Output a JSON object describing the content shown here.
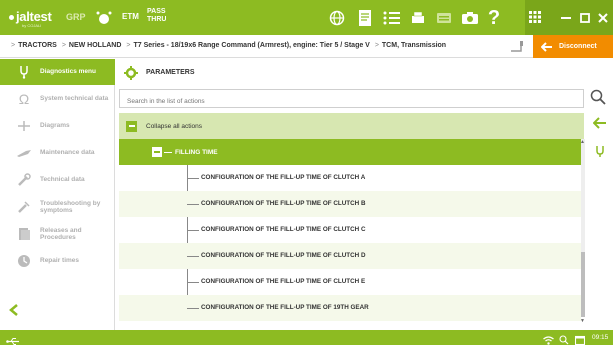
{
  "topbar": {
    "logo": "jaltest",
    "logo_sub": "by COJALI",
    "grp": "GRP",
    "etm": "ETM",
    "passthru_line1": "PASS",
    "passthru_line2": "THRU",
    "help": "?"
  },
  "breadcrumb": {
    "items": [
      "TRACTORS",
      "NEW HOLLAND",
      "T7 Series - 18/19x6 Range Command (Armrest), engine: Tier 5 / Stage V",
      "TCM, Transmission"
    ],
    "disconnect_label": "Disconnect"
  },
  "sidebar": {
    "items": [
      {
        "label": "Diagnostics menu",
        "icon": "diagnostics-icon",
        "active": true
      },
      {
        "label": "System technical data",
        "icon": "omega-icon"
      },
      {
        "label": "Diagrams",
        "icon": "diagram-icon"
      },
      {
        "label": "Maintenance data",
        "icon": "maintenance-icon"
      },
      {
        "label": "Technical data",
        "icon": "wrench-icon"
      },
      {
        "label": "Troubleshooting by symptoms",
        "icon": "troubleshooting-icon"
      },
      {
        "label": "Releases and Procedures",
        "icon": "procedures-icon"
      },
      {
        "label": "Repair times",
        "icon": "repair-times-icon"
      }
    ]
  },
  "main": {
    "title": "PARAMETERS",
    "search_placeholder": "Search in the list of actions",
    "collapse_label": "Collapse all actions",
    "group_label": "FILLING TIME",
    "actions": [
      "CONFIGURATION OF THE FILL-UP TIME OF CLUTCH A",
      "CONFIGURATION OF THE FILL-UP TIME OF CLUTCH B",
      "CONFIGURATION OF THE FILL-UP TIME OF CLUTCH C",
      "CONFIGURATION OF THE FILL-UP TIME OF CLUTCH D",
      "CONFIGURATION OF THE FILL-UP TIME OF CLUTCH E",
      "CONFIGURATION OF THE FILL-UP TIME OF 19TH GEAR"
    ]
  },
  "statusbar": {
    "time": "09:15"
  },
  "colors": {
    "brand_green": "#8dbb22",
    "disconnect_orange": "#f28c00",
    "collapse_bg": "#d7e7b1"
  }
}
